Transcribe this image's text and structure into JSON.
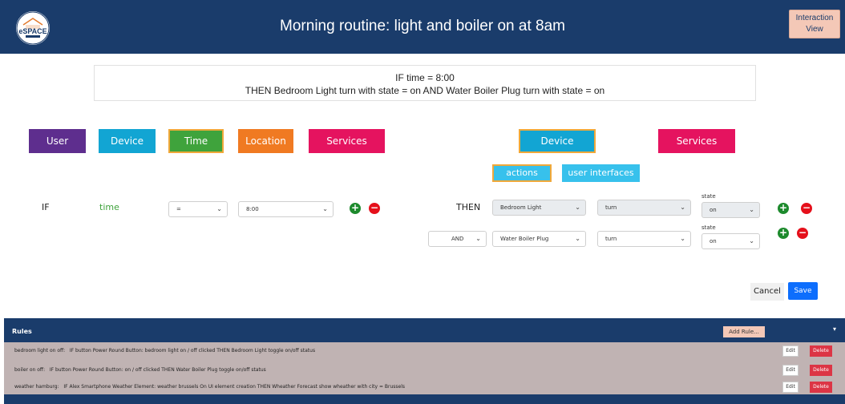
{
  "header": {
    "title": "Morning routine: light and boiler on at 8am",
    "interaction_view_label": "Interaction View",
    "logo_text": "eSPACE"
  },
  "summary": {
    "line1": "IF time = 8:00",
    "line2": "THEN Bedroom Light turn with state = on AND Water Boiler Plug turn with state = on"
  },
  "trigger_categories": [
    {
      "label": "User",
      "color": "#5e2e8e",
      "selected": false
    },
    {
      "label": "Device",
      "color": "#12a5d3",
      "selected": false
    },
    {
      "label": "Time",
      "color": "#3fa33c",
      "selected": true
    },
    {
      "label": "Location",
      "color": "#f07a22",
      "selected": false
    },
    {
      "label": "Services",
      "color": "#e5135f",
      "selected": false
    }
  ],
  "action_categories": [
    {
      "label": "Device",
      "color": "#12a5d3",
      "selected": true
    },
    {
      "label": "Services",
      "color": "#e5135f",
      "selected": false
    }
  ],
  "device_subtabs": [
    {
      "label": "actions",
      "selected": true
    },
    {
      "label": "user interfaces",
      "selected": false
    }
  ],
  "condition": {
    "if_label": "IF",
    "type_label": "time",
    "operator": "=",
    "value": "8:00"
  },
  "actions": {
    "then_label": "THEN",
    "rows": [
      {
        "connector": "",
        "device": "Bedroom Light",
        "action": "turn",
        "state_label": "state",
        "state": "on"
      },
      {
        "connector": "AND",
        "device": "Water Boiler Plug",
        "action": "turn",
        "state_label": "state",
        "state": "on"
      }
    ]
  },
  "footer_buttons": {
    "cancel": "Cancel",
    "save": "Save"
  },
  "rules": {
    "title": "Rules",
    "add_label": "Add Rule...",
    "edit_label": "Edit",
    "delete_label": "Delete",
    "items": [
      {
        "name": "bedroom light on off:",
        "text": "IF button Power Round Button: bedroom light on / off clicked THEN Bedroom Light toggle on/off status"
      },
      {
        "name": "boiler on off:",
        "text": "IF button Power Round Button: on / off clicked THEN Water Boiler Plug toggle on/off status"
      },
      {
        "name": "weather hamburg:",
        "text": "IF Alex Smartphone Weather Element: weather brussels On UI element creation THEN Wheather Forecast show wheather with city = Brussels"
      }
    ]
  },
  "colors": {
    "header_bg": "#1a3c6b",
    "highlight_border": "#f0a83a",
    "save_button": "#0d6efd",
    "delete_button": "#dc3545",
    "plus_icon": "#1d8a2d",
    "minus_icon": "#e5101b"
  }
}
